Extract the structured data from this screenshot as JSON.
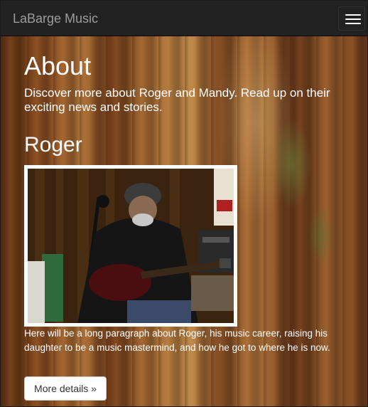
{
  "navbar": {
    "brand": "LaBarge Music",
    "menu_icon": "hamburger-menu-icon"
  },
  "main": {
    "title": "About",
    "lead": "Discover more about Roger and Mandy. Read up on their exciting news and stories.",
    "section": {
      "heading": "Roger",
      "photo_alt": "Roger playing guitar",
      "description": "Here will be a long paragraph about Roger, his music career, raising his daughter to be a music mastermind, and how he got to where he is now.",
      "details_button": "More details »"
    }
  },
  "colors": {
    "navbar_bg": "#222222",
    "brand_text": "#9d9d9d",
    "content_text": "#ffffff"
  }
}
